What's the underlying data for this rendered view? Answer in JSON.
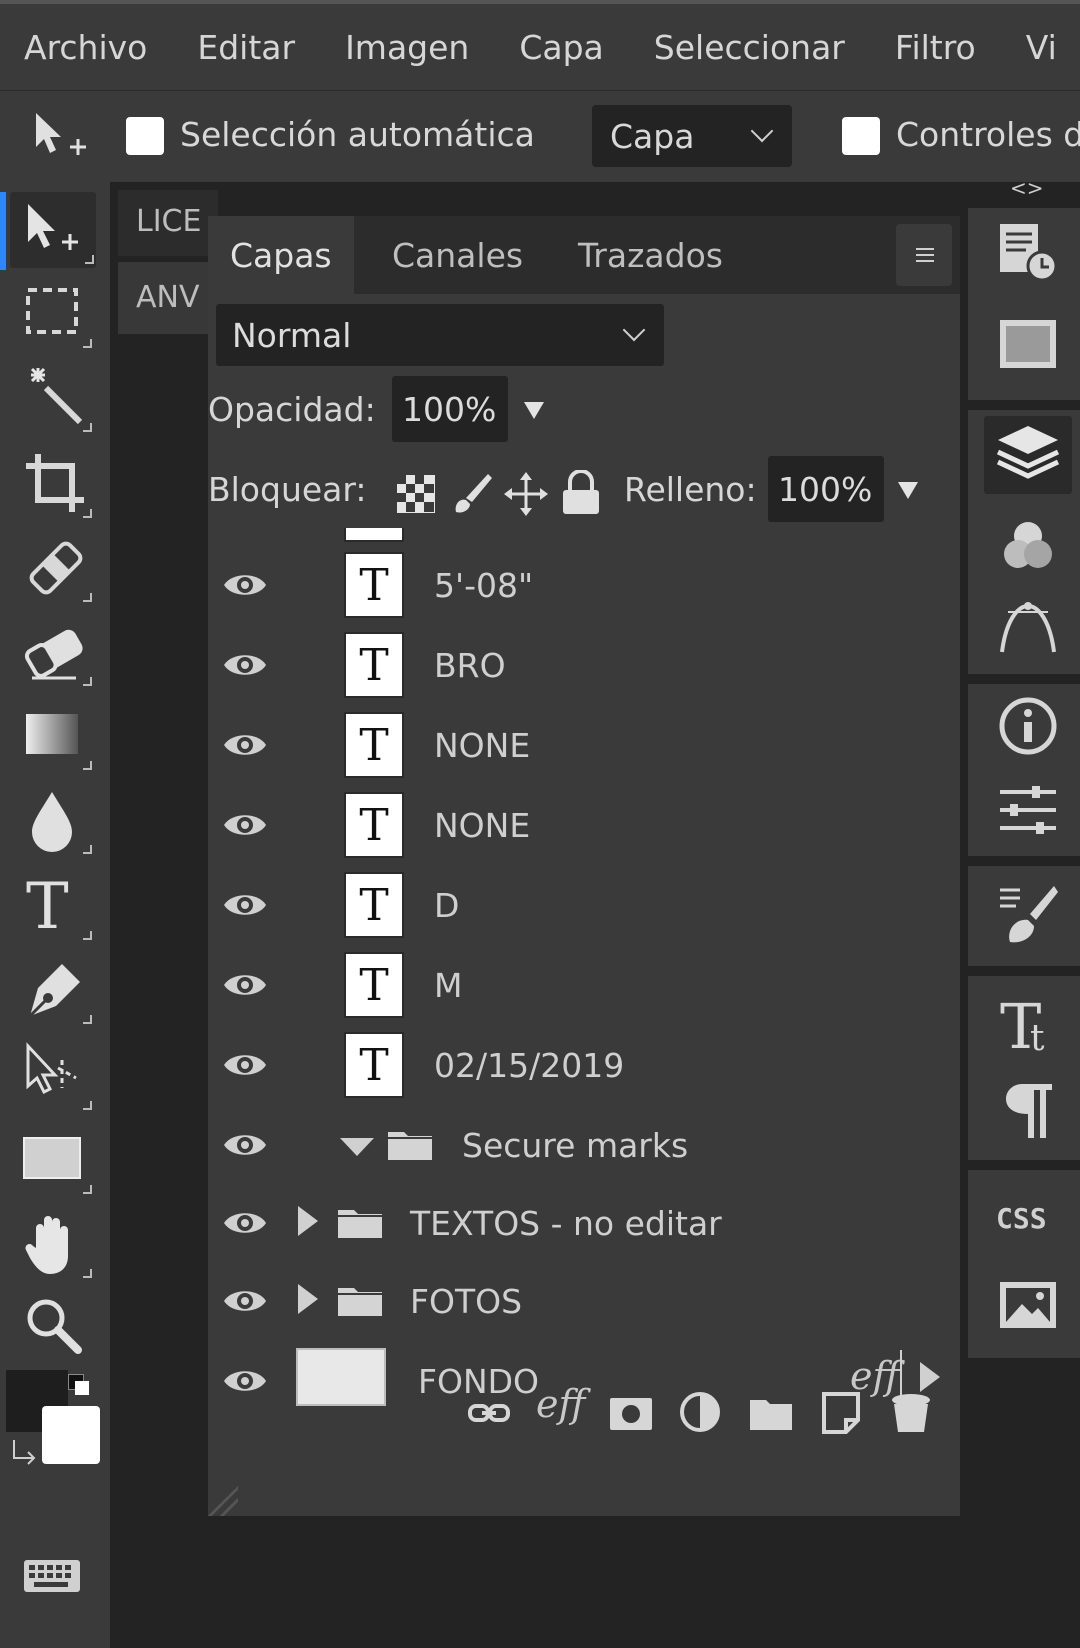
{
  "menu": [
    "Archivo",
    "Editar",
    "Imagen",
    "Capa",
    "Seleccionar",
    "Filtro",
    "Vi"
  ],
  "options": {
    "auto_select_label": "Selección automática",
    "auto_select_target": "Capa",
    "controls_label": "Controles d"
  },
  "doc_tabs": [
    "LICE",
    "ANV"
  ],
  "panel": {
    "tabs": [
      "Capas",
      "Canales",
      "Trazados"
    ],
    "blend_mode": "Normal",
    "opacity_label": "Opacidad:",
    "opacity_value": "100%",
    "lock_label": "Bloquear:",
    "fill_label": "Relleno:",
    "fill_value": "100%",
    "layers": [
      {
        "name": "5'-08\"",
        "type": "text",
        "visible": true
      },
      {
        "name": "BRO",
        "type": "text",
        "visible": true
      },
      {
        "name": "NONE",
        "type": "text",
        "visible": true
      },
      {
        "name": "NONE",
        "type": "text",
        "visible": true
      },
      {
        "name": "D",
        "type": "text",
        "visible": true
      },
      {
        "name": "M",
        "type": "text",
        "visible": true
      },
      {
        "name": "02/15/2019",
        "type": "text",
        "visible": true
      },
      {
        "name": "Secure marks",
        "type": "folder",
        "expanded": true,
        "visible": true
      },
      {
        "name": "TEXTOS - no editar",
        "type": "folder",
        "expanded": false,
        "visible": true
      },
      {
        "name": "FOTOS",
        "type": "folder",
        "expanded": false,
        "visible": true
      },
      {
        "name": "FONDO",
        "type": "image",
        "visible": true,
        "effects": "eff"
      }
    ],
    "text_thumb_glyph": "T",
    "footer_icons": [
      "link-icon",
      "effects-icon",
      "mask-icon",
      "adjustment-icon",
      "new-folder-icon",
      "new-layer-icon",
      "trash-icon"
    ],
    "footer_eff": "eff"
  },
  "tools": [
    "move-tool-icon",
    "marquee-tool-icon",
    "magic-wand-icon",
    "crop-tool-icon",
    "healing-brush-icon",
    "eraser-icon",
    "gradient-icon",
    "blur-drop-icon",
    "type-tool-icon",
    "pen-tool-icon",
    "path-select-icon",
    "rectangle-shape-icon",
    "hand-tool-icon",
    "zoom-tool-icon",
    "color-swatches",
    "keyboard-icon"
  ],
  "dock": {
    "icons": [
      "history-icon",
      "swatches-icon",
      "layers-icon",
      "channels-icon",
      "paths-icon",
      "info-icon",
      "properties-icon",
      "brush-icon",
      "character-icon",
      "paragraph-icon",
      "css-icon",
      "image-icon"
    ],
    "css_label": "CSS",
    "collapse_label": "<>"
  },
  "colors": {
    "accent": "#2f86f6",
    "panel_bg": "#3a3a3a",
    "dark_bg": "#232323",
    "foreground_color": "#1e1e1e",
    "background_color": "#ffffff"
  }
}
